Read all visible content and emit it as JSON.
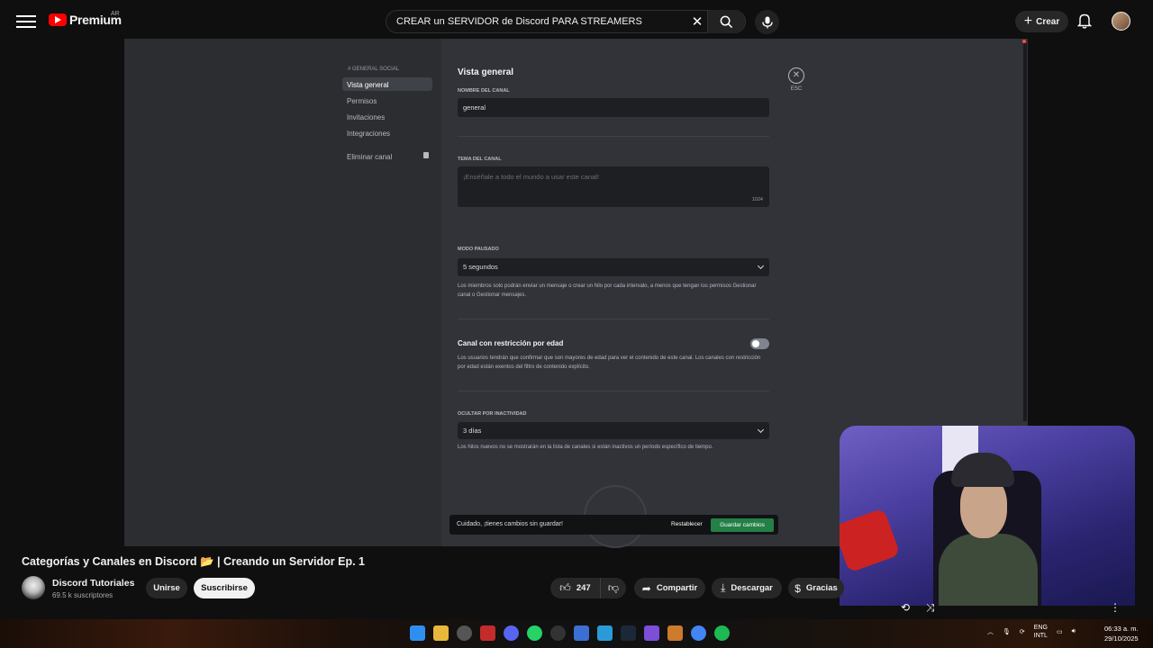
{
  "youtube": {
    "logo_text": "Premium",
    "country": "AR",
    "search_value": "CREAR un SERVIDOR de Discord PARA STREAMERS",
    "create_label": "Crear"
  },
  "discord": {
    "category": "# GENERAL SOCIAL",
    "nav": [
      "Vista general",
      "Permisos",
      "Invitaciones",
      "Integraciones"
    ],
    "delete_label": "Eliminar canal",
    "title": "Vista general",
    "name_label": "NOMBRE DEL CANAL",
    "name_value": "general",
    "topic_label": "TEMA DEL CANAL",
    "topic_placeholder": "¡Enséñale a todo el mundo a usar este canal!",
    "topic_counter": "1024",
    "slowmode_label": "MODO PAUSADO",
    "slowmode_value": "5 segundos",
    "slowmode_help": "Los miembros solo podrán enviar un mensaje o crear un hilo por cada intervalo, a menos que tengan los permisos Gestionar canal o Gestionar mensajes.",
    "nsfw_label": "Canal con restricción por edad",
    "nsfw_help": "Los usuarios tendrán que confirmar que son mayores de edad para ver el contenido de este canal. Los canales con restricción por edad están exentos del filtro de contenido explícito.",
    "archive_label": "OCULTAR POR INACTIVIDAD",
    "archive_value": "3 días",
    "archive_help": "Los hilos nuevos no se mostrarán en la lista de canales si están inactivos un período específico de tiempo.",
    "esc_label": "ESC",
    "unsaved_msg": "Cuidado, ¡tienes cambios sin guardar!",
    "reset_label": "Restablecer",
    "save_label": "Guardar cambios"
  },
  "video": {
    "title": "Categorías y Canales en Discord 📂 | Creando un Servidor Ep. 1",
    "channel_name": "Discord Tutoriales",
    "subscribers": "69.5 k suscriptores",
    "join_label": "Unirse",
    "subscribe_label": "Suscribirse",
    "likes": "247",
    "share_label": "Compartir",
    "download_label": "Descargar",
    "thanks_label": "Gracias"
  },
  "taskbar": {
    "lang_top": "ENG",
    "lang_bottom": "INTL",
    "time": "06:33 a. m.",
    "date": "29/10/2025"
  }
}
